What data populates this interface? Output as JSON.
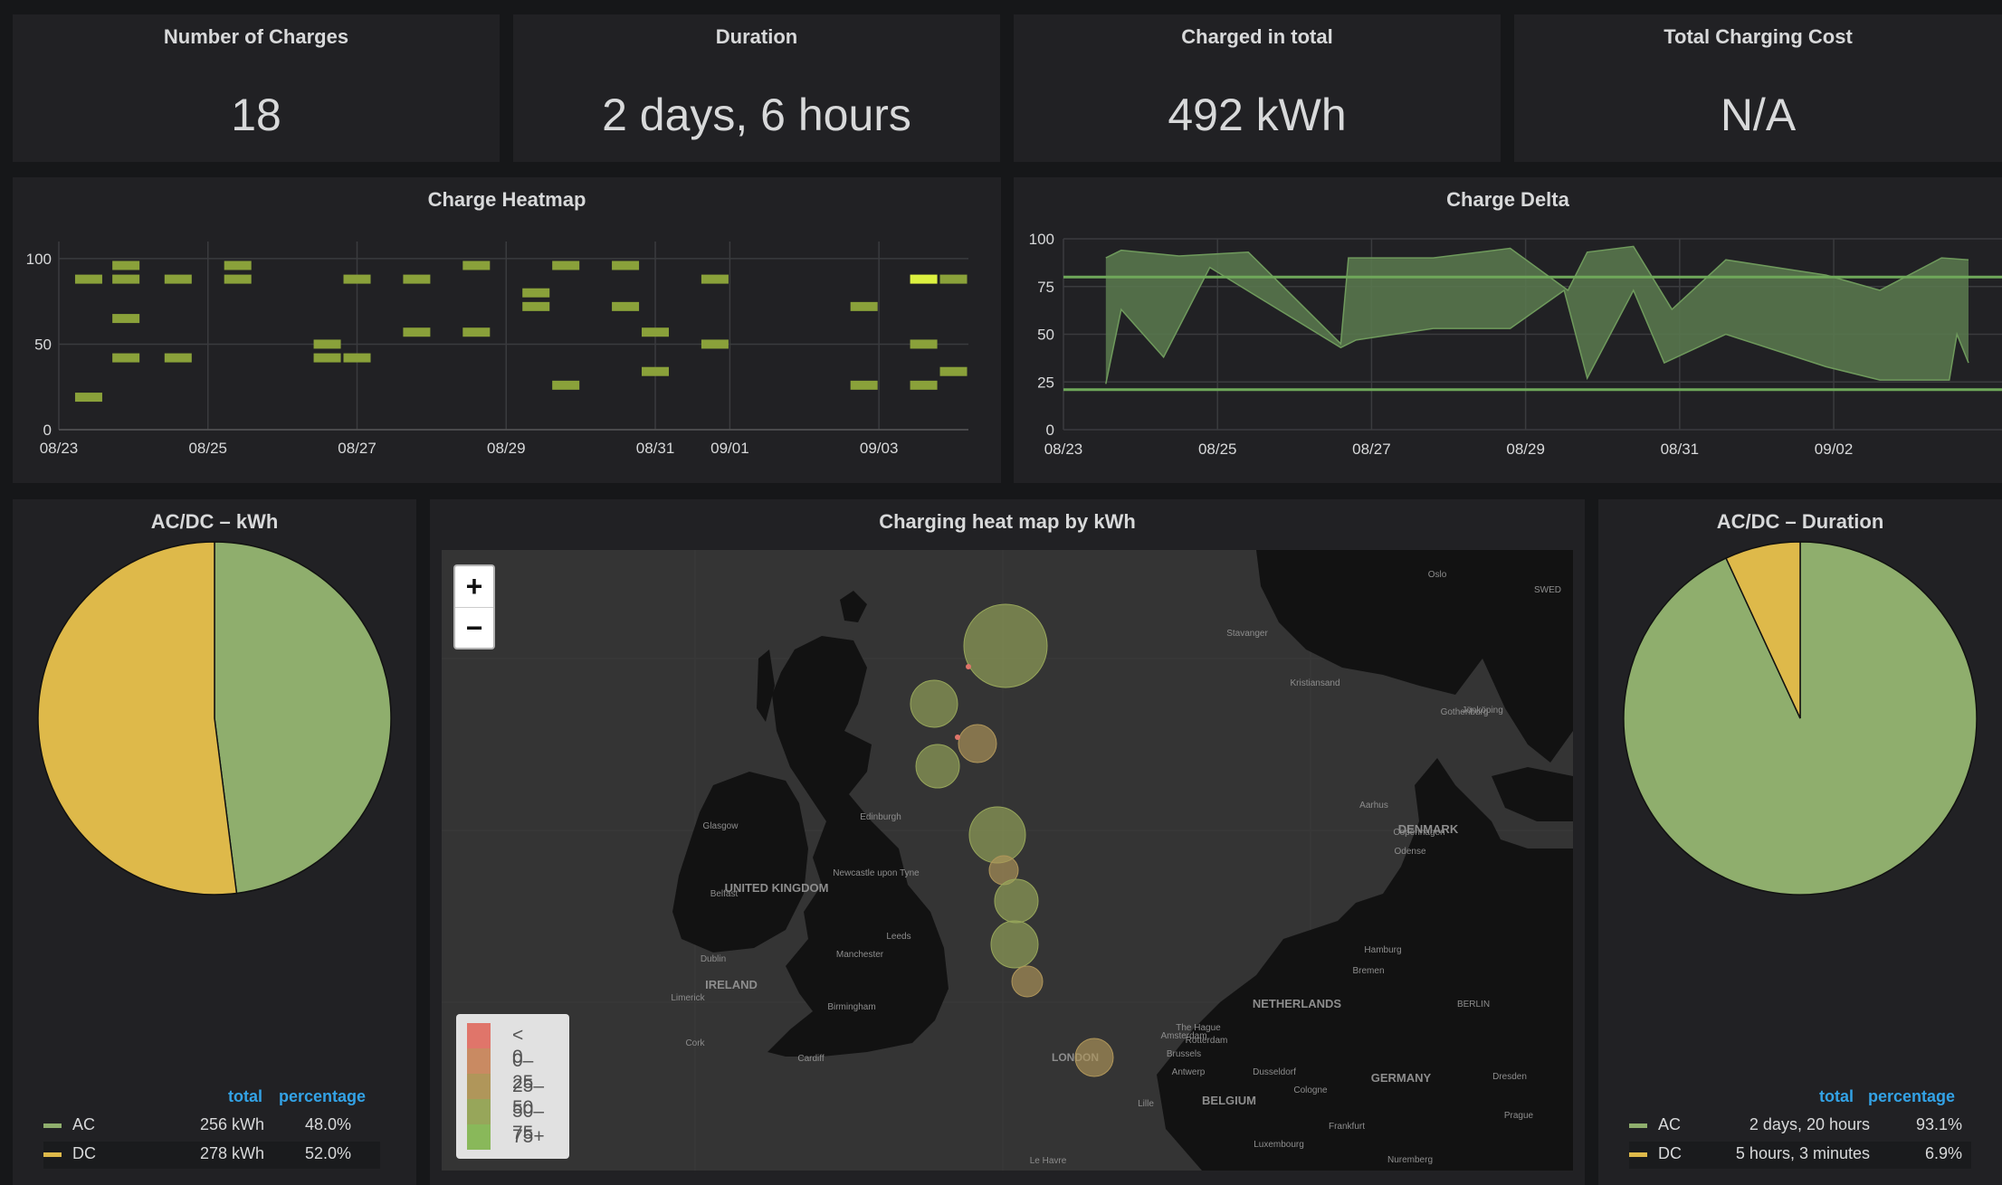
{
  "stats": [
    {
      "title": "Number of Charges",
      "value": "18"
    },
    {
      "title": "Duration",
      "value": "2 days, 6 hours"
    },
    {
      "title": "Charged in total",
      "value": "492 kWh"
    },
    {
      "title": "Total Charging Cost",
      "value": "N/A"
    }
  ],
  "heatmap_panel": {
    "title": "Charge Heatmap"
  },
  "delta_panel": {
    "title": "Charge Delta"
  },
  "ac_dc_kwh": {
    "title": "AC/DC – kWh",
    "legend_headers": {
      "total": "total",
      "percentage": "percentage"
    },
    "rows": [
      {
        "label": "AC",
        "total": "256 kWh",
        "percentage": "48.0%"
      },
      {
        "label": "DC",
        "total": "278 kWh",
        "percentage": "52.0%"
      }
    ]
  },
  "map_panel": {
    "title": "Charging heat map by kWh",
    "zoom_in": "+",
    "zoom_out": "−",
    "legend": [
      "< 0",
      "0–25",
      "25–50",
      "50–75",
      "75+"
    ],
    "legend_colors": [
      "#e0756a",
      "#c98a62",
      "#b0965a",
      "#97a65a",
      "#89b85a"
    ],
    "place_labels": [
      "UNITED KINGDOM",
      "IRELAND",
      "NETHERLANDS",
      "BELGIUM",
      "GERMANY",
      "DENMARK",
      "LONDON",
      "Glasgow",
      "Edinburgh",
      "Newcastle upon Tyne",
      "Leeds",
      "Manchester",
      "Birmingham",
      "Cardiff",
      "Dublin",
      "Belfast",
      "Cork",
      "Limerick",
      "Aarhus",
      "Copenhagen",
      "Hamburg",
      "Bremen",
      "BERLIN",
      "Stavanger",
      "Kristiansand",
      "Jönköping",
      "Gothenburg",
      "Oslo",
      "Odense",
      "Amsterdam",
      "The Hague",
      "Rotterdam",
      "Antwerp",
      "Brussels",
      "Cologne",
      "Dusseldorf",
      "Frankfurt",
      "Dresden",
      "Prague",
      "Nuremberg",
      "Luxembourg",
      "Lille",
      "Le Havre",
      "SWED"
    ],
    "bubbles": [
      {
        "location": "Orkney",
        "kwh_band": "50–75"
      },
      {
        "location": "Highlands west",
        "kwh_band": "50–75"
      },
      {
        "location": "Inverness",
        "kwh_band": "25–50"
      },
      {
        "location": "Fort William",
        "kwh_band": "50–75"
      },
      {
        "location": "Edinburgh",
        "kwh_band": "50–75"
      },
      {
        "location": "Newcastle upon Tyne",
        "kwh_band": "25–50"
      },
      {
        "location": "Durham",
        "kwh_band": "50–75"
      },
      {
        "location": "Leeds",
        "kwh_band": "50–75"
      },
      {
        "location": "Sheffield",
        "kwh_band": "25–50"
      },
      {
        "location": "London",
        "kwh_band": "25–50"
      }
    ]
  },
  "ac_dc_duration": {
    "title": "AC/DC – Duration",
    "legend_headers": {
      "total": "total",
      "percentage": "percentage"
    },
    "rows": [
      {
        "label": "AC",
        "total": "2 days, 20 hours",
        "percentage": "93.1%"
      },
      {
        "label": "DC",
        "total": "5 hours, 3 minutes",
        "percentage": "6.9%"
      }
    ]
  },
  "colors": {
    "ac": "#8fae6d",
    "dc": "#deb94a",
    "series_green": "#7eb26d",
    "accent_blue": "#33a2e5",
    "highlight": "#dcf040"
  },
  "chart_data": [
    {
      "type": "heatmap",
      "title": "Charge Heatmap",
      "x_tick_labels": [
        "08/23",
        "08/25",
        "08/27",
        "08/29",
        "08/31",
        "09/01",
        "09/03"
      ],
      "y_tick_labels": [
        "0",
        "50",
        "100"
      ],
      "ylim": [
        0,
        110
      ],
      "grid": true,
      "cells": [
        {
          "day": 23.4,
          "y": 88
        },
        {
          "day": 23.4,
          "y": 19
        },
        {
          "day": 23.9,
          "y": 96
        },
        {
          "day": 23.9,
          "y": 88
        },
        {
          "day": 23.9,
          "y": 65
        },
        {
          "day": 23.9,
          "y": 42
        },
        {
          "day": 24.6,
          "y": 88
        },
        {
          "day": 24.6,
          "y": 42
        },
        {
          "day": 25.4,
          "y": 96
        },
        {
          "day": 25.4,
          "y": 88
        },
        {
          "day": 26.6,
          "y": 50
        },
        {
          "day": 26.6,
          "y": 42
        },
        {
          "day": 27.0,
          "y": 88
        },
        {
          "day": 27.0,
          "y": 42
        },
        {
          "day": 27.8,
          "y": 88
        },
        {
          "day": 27.8,
          "y": 57
        },
        {
          "day": 28.6,
          "y": 96
        },
        {
          "day": 28.6,
          "y": 57
        },
        {
          "day": 29.4,
          "y": 80
        },
        {
          "day": 29.4,
          "y": 72
        },
        {
          "day": 29.8,
          "y": 96
        },
        {
          "day": 29.8,
          "y": 26
        },
        {
          "day": 30.6,
          "y": 96
        },
        {
          "day": 30.6,
          "y": 72
        },
        {
          "day": 31.0,
          "y": 57
        },
        {
          "day": 31.0,
          "y": 34
        },
        {
          "day": 31.8,
          "y": 88
        },
        {
          "day": 31.8,
          "y": 50
        },
        {
          "day": 33.8,
          "y": 72
        },
        {
          "day": 33.8,
          "y": 26
        },
        {
          "day": 34.6,
          "y": 88,
          "highlight": true
        },
        {
          "day": 34.6,
          "y": 50
        },
        {
          "day": 34.6,
          "y": 26
        },
        {
          "day": 35.0,
          "y": 88
        },
        {
          "day": 35.0,
          "y": 34
        }
      ]
    },
    {
      "type": "area",
      "title": "Charge Delta",
      "x_tick_labels": [
        "08/23",
        "08/25",
        "08/27",
        "08/29",
        "08/31",
        "09/02"
      ],
      "y_tick_labels": [
        "0",
        "25",
        "50",
        "75",
        "100"
      ],
      "ylim": [
        0,
        100
      ],
      "grid": true,
      "thresholds": [
        80,
        21
      ],
      "upper": [
        [
          23.55,
          90
        ],
        [
          23.75,
          94
        ],
        [
          24.5,
          91
        ],
        [
          25.4,
          93
        ],
        [
          26.6,
          45
        ],
        [
          26.7,
          90
        ],
        [
          27.8,
          90
        ],
        [
          28.8,
          95
        ],
        [
          29.55,
          73
        ],
        [
          29.8,
          93
        ],
        [
          30.4,
          96
        ],
        [
          30.9,
          63
        ],
        [
          31.6,
          89
        ],
        [
          32.9,
          81
        ],
        [
          33.6,
          73
        ],
        [
          34.4,
          90
        ],
        [
          34.75,
          89
        ]
      ],
      "lower": [
        [
          23.55,
          24
        ],
        [
          23.75,
          63
        ],
        [
          24.3,
          38
        ],
        [
          24.9,
          85
        ],
        [
          26.6,
          43
        ],
        [
          26.8,
          47
        ],
        [
          27.8,
          53
        ],
        [
          28.8,
          53
        ],
        [
          29.5,
          73
        ],
        [
          29.8,
          27
        ],
        [
          30.4,
          73
        ],
        [
          30.8,
          35
        ],
        [
          31.6,
          50
        ],
        [
          32.9,
          33
        ],
        [
          33.6,
          26
        ],
        [
          34.5,
          26
        ],
        [
          34.6,
          50
        ],
        [
          34.75,
          35
        ]
      ]
    },
    {
      "type": "pie",
      "title": "AC/DC – kWh",
      "labels": [
        "AC",
        "DC"
      ],
      "values": [
        256,
        278
      ],
      "percentages": [
        48.0,
        52.0
      ]
    },
    {
      "type": "pie",
      "title": "AC/DC – Duration",
      "labels": [
        "AC",
        "DC"
      ],
      "percentages": [
        93.1,
        6.9
      ]
    }
  ]
}
